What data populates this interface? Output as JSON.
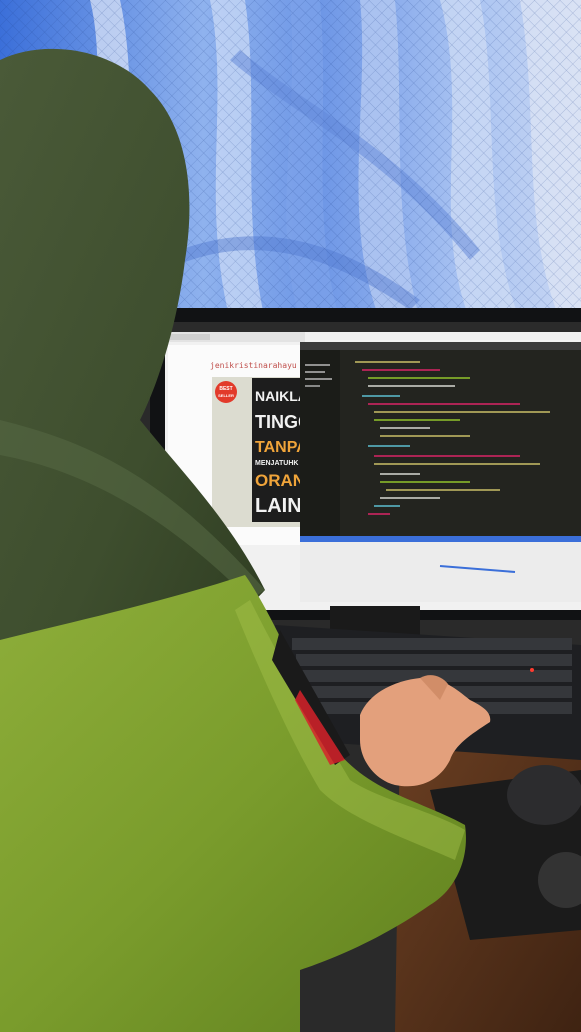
{
  "photo": {
    "screen": {
      "site_name": "jenikristinarahayu",
      "book_cover": {
        "badge_line1": "BEST",
        "badge_line2": "SELLER",
        "lines": [
          "NAIKLA",
          "TINGG",
          "TANPA",
          "MENJATUHK",
          "ORAN",
          "LAIN"
        ]
      }
    }
  }
}
